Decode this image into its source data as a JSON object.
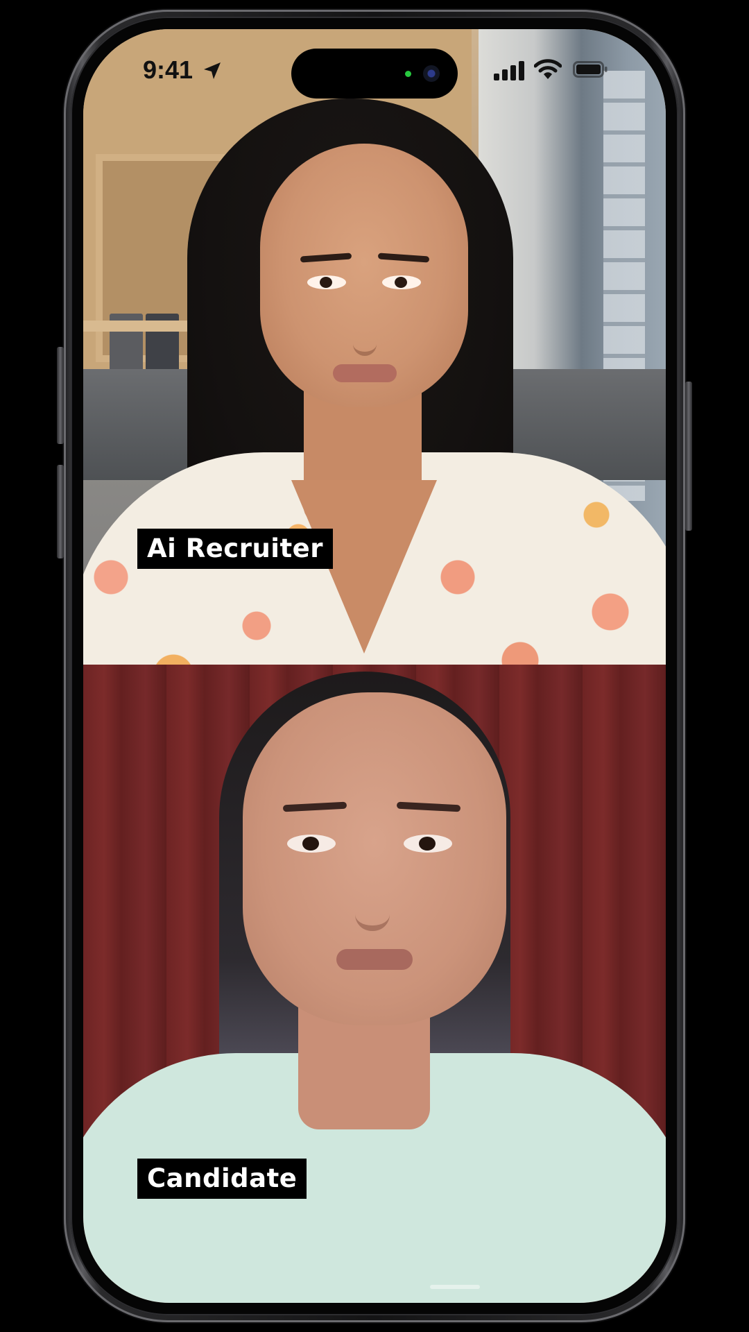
{
  "status_bar": {
    "time": "9:41",
    "icons": [
      "location-arrow-icon",
      "cellular-signal-icon",
      "wifi-icon",
      "battery-icon"
    ]
  },
  "call": {
    "top_participant_label": "Ai Recruiter",
    "bottom_participant_label": "Candidate"
  },
  "colors": {
    "label_background": "#000000",
    "label_text": "#ffffff",
    "indicator_green": "#27c93f"
  }
}
